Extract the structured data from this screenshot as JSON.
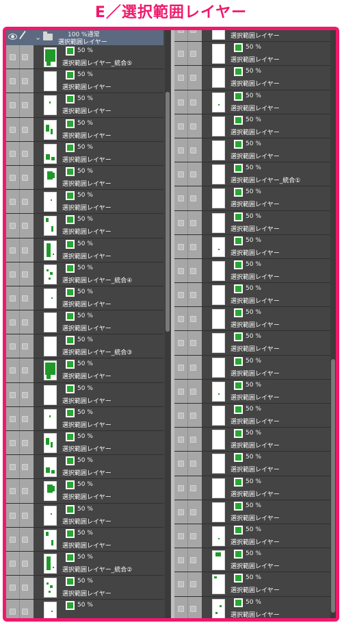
{
  "title": "E／選択範囲レイヤー",
  "header": {
    "opacity_label": "100 %通常",
    "folder_name": "選択範囲レイヤー"
  },
  "left_layers": [
    {
      "pct": "50 %",
      "name": "選択範囲レイヤー_統合⑤"
    },
    {
      "pct": "50 %",
      "name": "選択範囲レイヤー"
    },
    {
      "pct": "50 %",
      "name": "選択範囲レイヤー"
    },
    {
      "pct": "50 %",
      "name": "選択範囲レイヤー"
    },
    {
      "pct": "50 %",
      "name": "選択範囲レイヤー"
    },
    {
      "pct": "50 %",
      "name": "選択範囲レイヤー"
    },
    {
      "pct": "50 %",
      "name": "選択範囲レイヤー"
    },
    {
      "pct": "50 %",
      "name": "選択範囲レイヤー"
    },
    {
      "pct": "50 %",
      "name": "選択範囲レイヤー"
    },
    {
      "pct": "50 %",
      "name": "選択範囲レイヤー_統合④"
    },
    {
      "pct": "50 %",
      "name": "選択範囲レイヤー"
    },
    {
      "pct": "50 %",
      "name": "選択範囲レイヤー"
    },
    {
      "pct": "50 %",
      "name": "選択範囲レイヤー_統合③"
    },
    {
      "pct": "50 %",
      "name": "選択範囲レイヤー"
    },
    {
      "pct": "50 %",
      "name": "選択範囲レイヤー"
    },
    {
      "pct": "50 %",
      "name": "選択範囲レイヤー"
    },
    {
      "pct": "50 %",
      "name": "選択範囲レイヤー"
    },
    {
      "pct": "50 %",
      "name": "選択範囲レイヤー"
    },
    {
      "pct": "50 %",
      "name": "選択範囲レイヤー"
    },
    {
      "pct": "50 %",
      "name": "選択範囲レイヤー"
    },
    {
      "pct": "50 %",
      "name": "選択範囲レイヤー"
    },
    {
      "pct": "50 %",
      "name": "選択範囲レイヤー_統合②"
    },
    {
      "pct": "50 %",
      "name": "選択範囲レイヤー"
    },
    {
      "pct": "50 %",
      "name": ""
    }
  ],
  "right_layers": [
    {
      "pct": "",
      "name": "選択範囲レイヤー"
    },
    {
      "pct": "50 %",
      "name": "選択範囲レイヤー"
    },
    {
      "pct": "50 %",
      "name": "選択範囲レイヤー"
    },
    {
      "pct": "50 %",
      "name": "選択範囲レイヤー"
    },
    {
      "pct": "50 %",
      "name": "選択範囲レイヤー"
    },
    {
      "pct": "50 %",
      "name": "選択範囲レイヤー"
    },
    {
      "pct": "50 %",
      "name": "選択範囲レイヤー_統合①"
    },
    {
      "pct": "50 %",
      "name": "選択範囲レイヤー"
    },
    {
      "pct": "50 %",
      "name": "選択範囲レイヤー"
    },
    {
      "pct": "50 %",
      "name": "選択範囲レイヤー"
    },
    {
      "pct": "50 %",
      "name": "選択範囲レイヤー"
    },
    {
      "pct": "50 %",
      "name": "選択範囲レイヤー"
    },
    {
      "pct": "50 %",
      "name": "選択範囲レイヤー"
    },
    {
      "pct": "50 %",
      "name": "選択範囲レイヤー"
    },
    {
      "pct": "50 %",
      "name": "選択範囲レイヤー"
    },
    {
      "pct": "50 %",
      "name": "選択範囲レイヤー"
    },
    {
      "pct": "50 %",
      "name": "選択範囲レイヤー"
    },
    {
      "pct": "50 %",
      "name": "選択範囲レイヤー"
    },
    {
      "pct": "50 %",
      "name": "選択範囲レイヤー"
    },
    {
      "pct": "50 %",
      "name": "選択範囲レイヤー"
    },
    {
      "pct": "50 %",
      "name": "選択範囲レイヤー"
    },
    {
      "pct": "50 %",
      "name": "選択範囲レイヤー"
    },
    {
      "pct": "50 %",
      "name": "選択範囲レイヤー"
    },
    {
      "pct": "50 %",
      "name": "選択範囲レイヤー"
    },
    {
      "pct": "50 %",
      "name": "選択範囲レイヤー"
    }
  ],
  "colors": {
    "frame": "#f0196c",
    "panel_bg": "#434343",
    "selection": "#5b6a80",
    "mask_green": "#2aa632",
    "thumb_mark_green": "#1f9a2a"
  }
}
